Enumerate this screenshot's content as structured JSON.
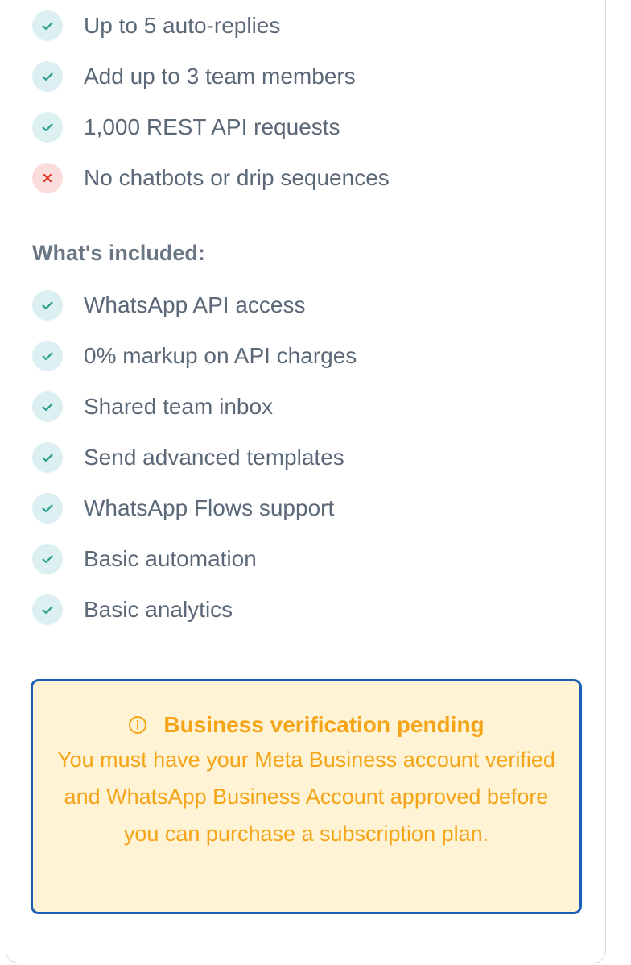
{
  "limits": [
    {
      "text": "Up to 5 auto-replies",
      "status": "included",
      "icon": "check-icon"
    },
    {
      "text": "Add up to 3 team members",
      "status": "included",
      "icon": "check-icon"
    },
    {
      "text": "1,000 REST API requests",
      "status": "included",
      "icon": "check-icon"
    },
    {
      "text": "No chatbots or drip sequences",
      "status": "excluded",
      "icon": "cross-icon"
    }
  ],
  "included_heading": "What's included:",
  "included": [
    {
      "text": "WhatsApp API access",
      "icon": "check-icon"
    },
    {
      "text": "0% markup on API charges",
      "icon": "check-icon"
    },
    {
      "text": "Shared team inbox",
      "icon": "check-icon"
    },
    {
      "text": "Send advanced templates",
      "icon": "check-icon"
    },
    {
      "text": "WhatsApp Flows support",
      "icon": "check-icon"
    },
    {
      "text": "Basic automation",
      "icon": "check-icon"
    },
    {
      "text": "Basic analytics",
      "icon": "check-icon"
    }
  ],
  "notice": {
    "icon": "info-icon",
    "title": "Business verification pending",
    "body": "You must have your Meta Business account verified and WhatsApp Business Account approved before you can purchase a subscription plan."
  },
  "colors": {
    "check": "#2a9d8f",
    "check_bg": "#dcf0f2",
    "cross": "#e0392b",
    "cross_bg": "#fbdcdc",
    "notice_text": "#f5a417",
    "notice_bg": "#fef3d4",
    "notice_border": "#1a5fb4"
  }
}
